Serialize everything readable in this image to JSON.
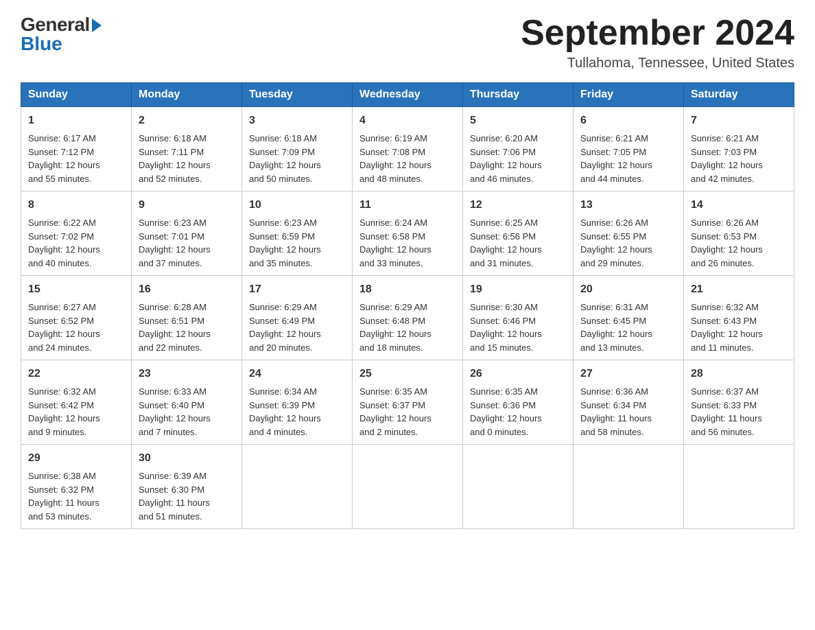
{
  "logo": {
    "general": "General",
    "blue": "Blue"
  },
  "title": {
    "month_year": "September 2024",
    "location": "Tullahoma, Tennessee, United States"
  },
  "headers": [
    "Sunday",
    "Monday",
    "Tuesday",
    "Wednesday",
    "Thursday",
    "Friday",
    "Saturday"
  ],
  "weeks": [
    [
      {
        "day": "1",
        "info": "Sunrise: 6:17 AM\nSunset: 7:12 PM\nDaylight: 12 hours\nand 55 minutes."
      },
      {
        "day": "2",
        "info": "Sunrise: 6:18 AM\nSunset: 7:11 PM\nDaylight: 12 hours\nand 52 minutes."
      },
      {
        "day": "3",
        "info": "Sunrise: 6:18 AM\nSunset: 7:09 PM\nDaylight: 12 hours\nand 50 minutes."
      },
      {
        "day": "4",
        "info": "Sunrise: 6:19 AM\nSunset: 7:08 PM\nDaylight: 12 hours\nand 48 minutes."
      },
      {
        "day": "5",
        "info": "Sunrise: 6:20 AM\nSunset: 7:06 PM\nDaylight: 12 hours\nand 46 minutes."
      },
      {
        "day": "6",
        "info": "Sunrise: 6:21 AM\nSunset: 7:05 PM\nDaylight: 12 hours\nand 44 minutes."
      },
      {
        "day": "7",
        "info": "Sunrise: 6:21 AM\nSunset: 7:03 PM\nDaylight: 12 hours\nand 42 minutes."
      }
    ],
    [
      {
        "day": "8",
        "info": "Sunrise: 6:22 AM\nSunset: 7:02 PM\nDaylight: 12 hours\nand 40 minutes."
      },
      {
        "day": "9",
        "info": "Sunrise: 6:23 AM\nSunset: 7:01 PM\nDaylight: 12 hours\nand 37 minutes."
      },
      {
        "day": "10",
        "info": "Sunrise: 6:23 AM\nSunset: 6:59 PM\nDaylight: 12 hours\nand 35 minutes."
      },
      {
        "day": "11",
        "info": "Sunrise: 6:24 AM\nSunset: 6:58 PM\nDaylight: 12 hours\nand 33 minutes."
      },
      {
        "day": "12",
        "info": "Sunrise: 6:25 AM\nSunset: 6:56 PM\nDaylight: 12 hours\nand 31 minutes."
      },
      {
        "day": "13",
        "info": "Sunrise: 6:26 AM\nSunset: 6:55 PM\nDaylight: 12 hours\nand 29 minutes."
      },
      {
        "day": "14",
        "info": "Sunrise: 6:26 AM\nSunset: 6:53 PM\nDaylight: 12 hours\nand 26 minutes."
      }
    ],
    [
      {
        "day": "15",
        "info": "Sunrise: 6:27 AM\nSunset: 6:52 PM\nDaylight: 12 hours\nand 24 minutes."
      },
      {
        "day": "16",
        "info": "Sunrise: 6:28 AM\nSunset: 6:51 PM\nDaylight: 12 hours\nand 22 minutes."
      },
      {
        "day": "17",
        "info": "Sunrise: 6:29 AM\nSunset: 6:49 PM\nDaylight: 12 hours\nand 20 minutes."
      },
      {
        "day": "18",
        "info": "Sunrise: 6:29 AM\nSunset: 6:48 PM\nDaylight: 12 hours\nand 18 minutes."
      },
      {
        "day": "19",
        "info": "Sunrise: 6:30 AM\nSunset: 6:46 PM\nDaylight: 12 hours\nand 15 minutes."
      },
      {
        "day": "20",
        "info": "Sunrise: 6:31 AM\nSunset: 6:45 PM\nDaylight: 12 hours\nand 13 minutes."
      },
      {
        "day": "21",
        "info": "Sunrise: 6:32 AM\nSunset: 6:43 PM\nDaylight: 12 hours\nand 11 minutes."
      }
    ],
    [
      {
        "day": "22",
        "info": "Sunrise: 6:32 AM\nSunset: 6:42 PM\nDaylight: 12 hours\nand 9 minutes."
      },
      {
        "day": "23",
        "info": "Sunrise: 6:33 AM\nSunset: 6:40 PM\nDaylight: 12 hours\nand 7 minutes."
      },
      {
        "day": "24",
        "info": "Sunrise: 6:34 AM\nSunset: 6:39 PM\nDaylight: 12 hours\nand 4 minutes."
      },
      {
        "day": "25",
        "info": "Sunrise: 6:35 AM\nSunset: 6:37 PM\nDaylight: 12 hours\nand 2 minutes."
      },
      {
        "day": "26",
        "info": "Sunrise: 6:35 AM\nSunset: 6:36 PM\nDaylight: 12 hours\nand 0 minutes."
      },
      {
        "day": "27",
        "info": "Sunrise: 6:36 AM\nSunset: 6:34 PM\nDaylight: 11 hours\nand 58 minutes."
      },
      {
        "day": "28",
        "info": "Sunrise: 6:37 AM\nSunset: 6:33 PM\nDaylight: 11 hours\nand 56 minutes."
      }
    ],
    [
      {
        "day": "29",
        "info": "Sunrise: 6:38 AM\nSunset: 6:32 PM\nDaylight: 11 hours\nand 53 minutes."
      },
      {
        "day": "30",
        "info": "Sunrise: 6:39 AM\nSunset: 6:30 PM\nDaylight: 11 hours\nand 51 minutes."
      },
      null,
      null,
      null,
      null,
      null
    ]
  ]
}
